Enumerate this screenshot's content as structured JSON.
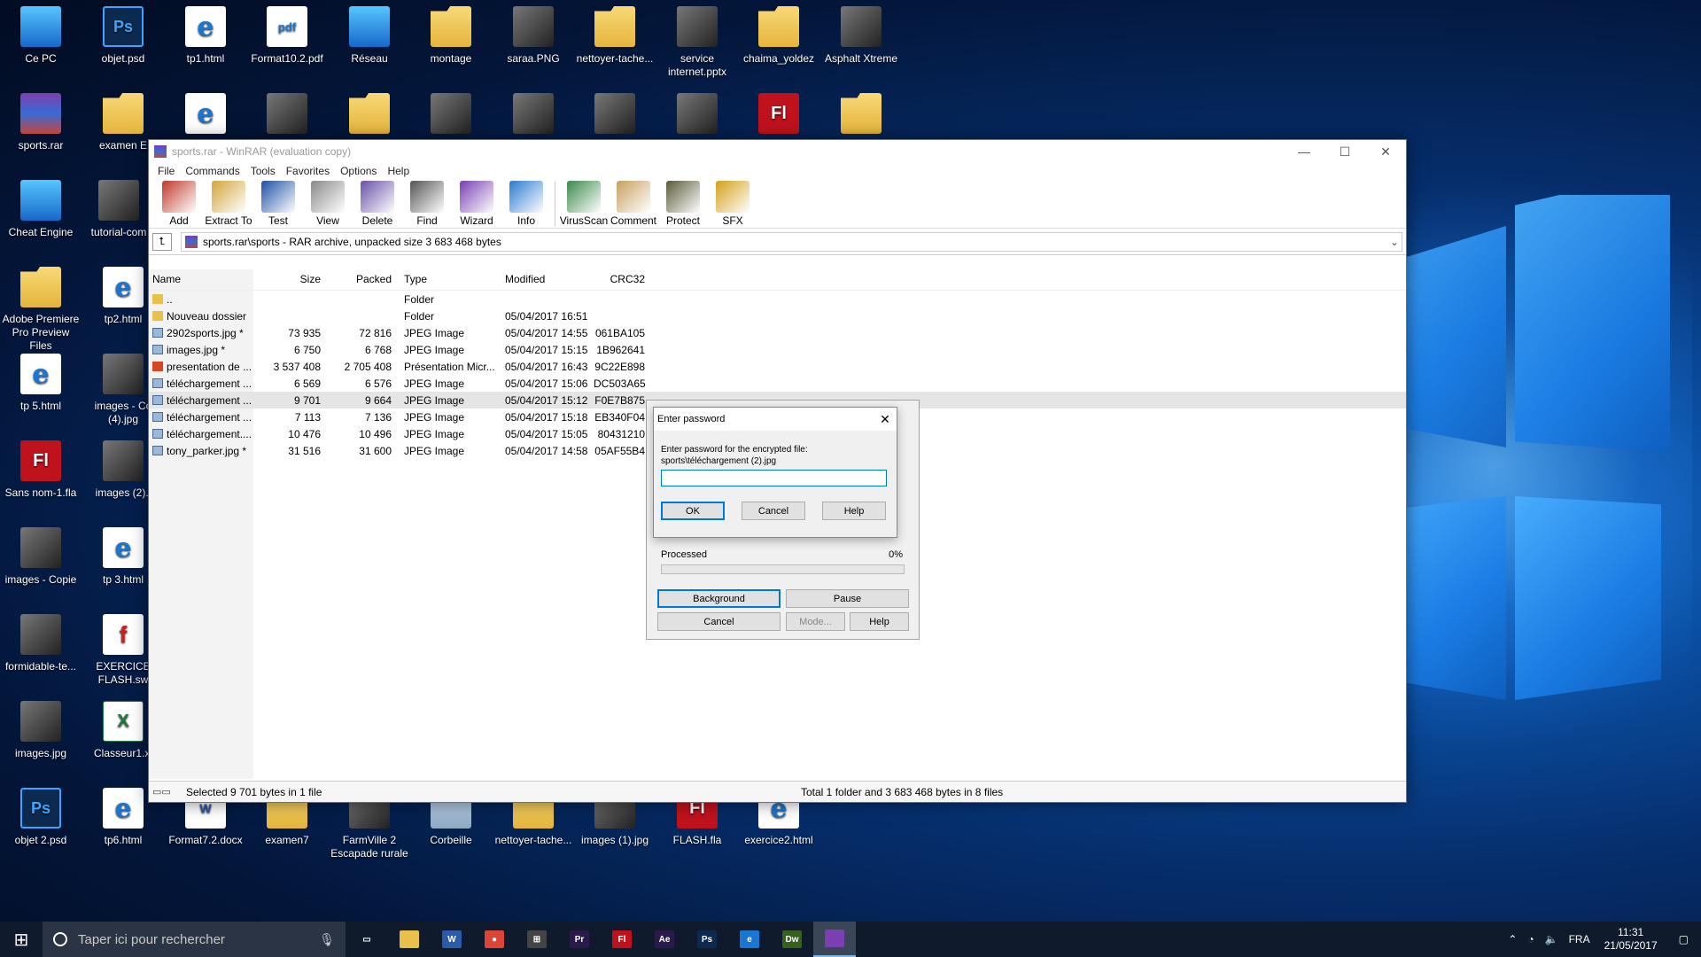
{
  "desktop": {
    "icons": [
      {
        "label": "Ce PC",
        "kind": "pc"
      },
      {
        "label": "objet.psd",
        "kind": "ps",
        "glyph": "Ps"
      },
      {
        "label": "tp1.html",
        "kind": "edge",
        "glyph": "e"
      },
      {
        "label": "Format10.2.pdf",
        "kind": "pdf",
        "glyph": "pdf"
      },
      {
        "label": "Réseau",
        "kind": "pc"
      },
      {
        "label": "montage",
        "kind": "folder"
      },
      {
        "label": "saraa.PNG",
        "kind": "img"
      },
      {
        "label": "nettoyer-tache...",
        "kind": "folder"
      },
      {
        "label": "service internet.pptx",
        "kind": "img"
      },
      {
        "label": "chaima_yoldez",
        "kind": "folder"
      },
      {
        "label": "Asphalt Xtreme",
        "kind": "img"
      },
      {
        "label": "sports.rar",
        "kind": "rar"
      },
      {
        "label": "examen E",
        "kind": "folder"
      },
      {
        "label": "",
        "kind": "edge",
        "glyph": "e"
      },
      {
        "label": "",
        "kind": "img"
      },
      {
        "label": "",
        "kind": "folder"
      },
      {
        "label": "",
        "kind": "img"
      },
      {
        "label": "",
        "kind": "img"
      },
      {
        "label": "",
        "kind": "img"
      },
      {
        "label": "",
        "kind": "img"
      },
      {
        "label": "",
        "kind": "fla",
        "glyph": "Fl"
      },
      {
        "label": "",
        "kind": "folder"
      },
      {
        "label": "Cheat Engine",
        "kind": "pc"
      },
      {
        "label": "tutorial-com",
        "kind": "img"
      },
      {
        "label": "Adobe Premiere Pro Preview Files",
        "kind": "folder"
      },
      {
        "label": "tp2.html",
        "kind": "edge",
        "glyph": "e"
      },
      {
        "label": "tp 5.html",
        "kind": "edge",
        "glyph": "e"
      },
      {
        "label": "images - Co (4).jpg",
        "kind": "img"
      },
      {
        "label": "Sans nom-1.fla",
        "kind": "fla",
        "glyph": "Fl"
      },
      {
        "label": "images (2).j",
        "kind": "img"
      },
      {
        "label": "images - Copie",
        "kind": "img"
      },
      {
        "label": "tp 3.html",
        "kind": "edge",
        "glyph": "e"
      },
      {
        "label": "formidable-te...",
        "kind": "img"
      },
      {
        "label": "EXERCICE FLASH.sw",
        "kind": "swf",
        "glyph": "f"
      },
      {
        "label": "images.jpg",
        "kind": "img"
      },
      {
        "label": "Classeur1.xl",
        "kind": "xl",
        "glyph": "X"
      },
      {
        "label": "objet 2.psd",
        "kind": "ps",
        "glyph": "Ps"
      },
      {
        "label": "tp6.html",
        "kind": "edge",
        "glyph": "e"
      },
      {
        "label": "Format7.2.docx",
        "kind": "doc",
        "glyph": "W"
      },
      {
        "label": "examen7",
        "kind": "folder"
      },
      {
        "label": "FarmVille 2 Escapade rurale",
        "kind": "img"
      },
      {
        "label": "Corbeille",
        "kind": "bin"
      },
      {
        "label": "nettoyer-tache...",
        "kind": "folder"
      },
      {
        "label": "images (1).jpg",
        "kind": "img"
      },
      {
        "label": "FLASH.fla",
        "kind": "fla",
        "glyph": "Fl"
      },
      {
        "label": "exercice2.html",
        "kind": "edge",
        "glyph": "e"
      }
    ]
  },
  "window": {
    "title": "sports.rar - WinRAR (evaluation copy)",
    "controls": {
      "minimize": "—",
      "maximize": "☐",
      "close": "✕"
    },
    "menu": [
      "File",
      "Commands",
      "Tools",
      "Favorites",
      "Options",
      "Help"
    ],
    "toolbar": [
      {
        "label": "Add",
        "color": "#c0392b"
      },
      {
        "label": "Extract To",
        "color": "#d4a53a"
      },
      {
        "label": "Test",
        "color": "#1d4fa3"
      },
      {
        "label": "View",
        "color": "#8a8a8a"
      },
      {
        "label": "Delete",
        "color": "#6a4fa8"
      },
      {
        "label": "Find",
        "color": "#555555"
      },
      {
        "label": "Wizard",
        "color": "#7a3fb0"
      },
      {
        "label": "Info",
        "color": "#2a7bd0"
      },
      {
        "label": "VirusScan",
        "color": "#3a8a4a"
      },
      {
        "label": "Comment",
        "color": "#c8a060"
      },
      {
        "label": "Protect",
        "color": "#5a5a3a"
      },
      {
        "label": "SFX",
        "color": "#d4a017"
      }
    ],
    "address": "sports.rar\\sports - RAR archive, unpacked size 3 683 468 bytes",
    "columns": {
      "name": "Name",
      "size": "Size",
      "packed": "Packed",
      "type": "Type",
      "modified": "Modified",
      "crc": "CRC32"
    },
    "files": [
      {
        "name": "..",
        "size": "",
        "packed": "",
        "type": "Folder",
        "modified": "",
        "crc": "",
        "icon": "folder",
        "selected": false
      },
      {
        "name": "Nouveau dossier",
        "size": "",
        "packed": "",
        "type": "Folder",
        "modified": "05/04/2017 16:51",
        "crc": "",
        "icon": "folder",
        "selected": false
      },
      {
        "name": "2902sports.jpg *",
        "size": "73 935",
        "packed": "72 816",
        "type": "JPEG Image",
        "modified": "05/04/2017 14:55",
        "crc": "061BA105",
        "icon": "jpg",
        "selected": false
      },
      {
        "name": "images.jpg *",
        "size": "6 750",
        "packed": "6 768",
        "type": "JPEG Image",
        "modified": "05/04/2017 15:15",
        "crc": "1B962641",
        "icon": "jpg",
        "selected": false
      },
      {
        "name": "presentation de ...",
        "size": "3 537 408",
        "packed": "2 705 408",
        "type": "Présentation Micr...",
        "modified": "05/04/2017 16:43",
        "crc": "9C22E898",
        "icon": "ppt",
        "selected": false
      },
      {
        "name": "téléchargement ...",
        "size": "6 569",
        "packed": "6 576",
        "type": "JPEG Image",
        "modified": "05/04/2017 15:06",
        "crc": "DC503A65",
        "icon": "jpg",
        "selected": false
      },
      {
        "name": "téléchargement ...",
        "size": "9 701",
        "packed": "9 664",
        "type": "JPEG Image",
        "modified": "05/04/2017 15:12",
        "crc": "F0E7B875",
        "icon": "jpg",
        "selected": true
      },
      {
        "name": "téléchargement ...",
        "size": "7 113",
        "packed": "7 136",
        "type": "JPEG Image",
        "modified": "05/04/2017 15:18",
        "crc": "EB340F04",
        "icon": "jpg",
        "selected": false
      },
      {
        "name": "téléchargement....",
        "size": "10 476",
        "packed": "10 496",
        "type": "JPEG Image",
        "modified": "05/04/2017 15:05",
        "crc": "80431210",
        "icon": "jpg",
        "selected": false
      },
      {
        "name": "tony_parker.jpg *",
        "size": "31 516",
        "packed": "31 600",
        "type": "JPEG Image",
        "modified": "05/04/2017 14:58",
        "crc": "05AF55B4",
        "icon": "jpg",
        "selected": false
      }
    ],
    "status_left": "Selected 9 701 bytes in 1 file",
    "status_right": "Total 1 folder and 3 683 468 bytes in 8 files"
  },
  "progress_dialog": {
    "processed_label": "Processed",
    "processed_pct": "0%",
    "processed_fraction": 0,
    "buttons": {
      "background": "Background",
      "pause": "Pause",
      "cancel": "Cancel",
      "mode": "Mode...",
      "help": "Help"
    }
  },
  "password_dialog": {
    "title": "Enter password",
    "close": "✕",
    "message_line1": "Enter password for the encrypted file:",
    "message_line2": "sports\\téléchargement (2).jpg",
    "value": "",
    "buttons": {
      "ok": "OK",
      "cancel": "Cancel",
      "help": "Help"
    }
  },
  "taskbar": {
    "search_placeholder": "Taper ici pour rechercher",
    "apps": [
      {
        "name": "task-view",
        "glyph": "▭",
        "color": "transparent",
        "active": false
      },
      {
        "name": "file-explorer",
        "glyph": "",
        "color": "#e8c04a",
        "active": false
      },
      {
        "name": "word",
        "glyph": "W",
        "color": "#2a5aa8",
        "active": false
      },
      {
        "name": "chrome",
        "glyph": "●",
        "color": "#db4437",
        "active": false
      },
      {
        "name": "store",
        "glyph": "⊞",
        "color": "#444",
        "active": false
      },
      {
        "name": "premiere",
        "glyph": "Pr",
        "color": "#2a1a4a",
        "active": false
      },
      {
        "name": "flash",
        "glyph": "Fl",
        "color": "#c0121d",
        "active": false
      },
      {
        "name": "after-effects",
        "glyph": "Ae",
        "color": "#2a1a4a",
        "active": false
      },
      {
        "name": "photoshop",
        "glyph": "Ps",
        "color": "#0c2a4f",
        "active": false
      },
      {
        "name": "edge",
        "glyph": "e",
        "color": "#1976d2",
        "active": false
      },
      {
        "name": "dreamweaver",
        "glyph": "Dw",
        "color": "#35601e",
        "active": false
      },
      {
        "name": "winrar",
        "glyph": "",
        "color": "#7a3fb0",
        "active": true
      }
    ],
    "tray": {
      "lang": "FRA",
      "time": "11:31",
      "date": "21/05/2017"
    }
  }
}
